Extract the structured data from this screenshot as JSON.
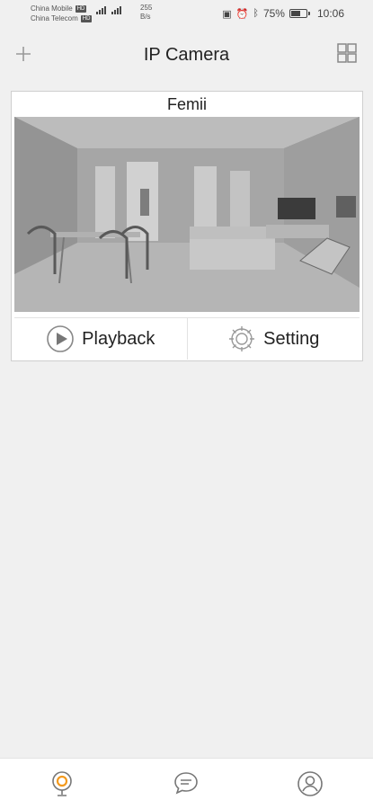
{
  "status_bar": {
    "carrier1": "China Mobile",
    "carrier1_badge": "HD",
    "carrier2": "China Telecom",
    "carrier2_badge": "HD",
    "net_speed_value": "255",
    "net_speed_unit": "B/s",
    "battery": "75%",
    "battery_level": 0.75,
    "time": "10:06",
    "icons": [
      "nfc-icon",
      "alarm-icon",
      "bluetooth-icon",
      "battery-icon"
    ]
  },
  "header": {
    "title": "IP Camera",
    "add_icon": "plus-icon",
    "layout_icon": "grid-layout-icon"
  },
  "camera_card": {
    "name": "Femii",
    "playback_label": "Playback",
    "setting_label": "Setting"
  },
  "bottom_nav": {
    "items": [
      {
        "icon": "camera-icon",
        "active": true
      },
      {
        "icon": "message-icon",
        "active": false
      },
      {
        "icon": "profile-icon",
        "active": false
      }
    ],
    "active_color": "#f39a1e"
  }
}
